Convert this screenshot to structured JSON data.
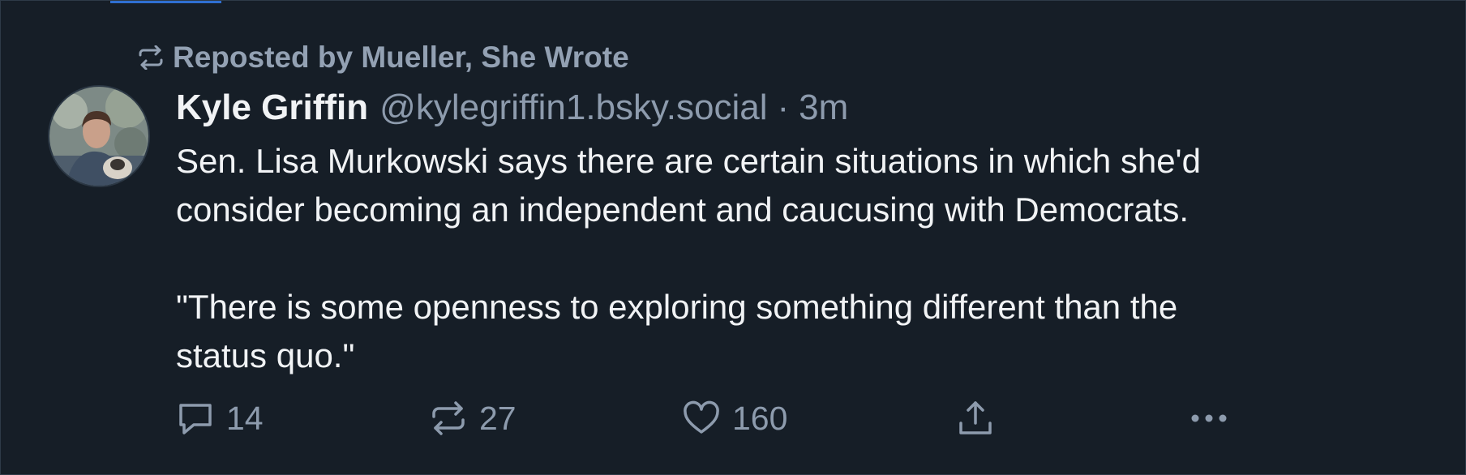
{
  "repost": {
    "icon": "repost-icon",
    "text": "Reposted by Mueller, She Wrote"
  },
  "post": {
    "author_name": "Kyle Griffin",
    "author_handle": "@kylegriffin1.bsky.social",
    "separator": "·",
    "timestamp": "3m",
    "body": {
      "paragraph1_line1": "Sen. Lisa Murkowski says there are certain situations in which she'd",
      "paragraph1_line2": "consider becoming an independent and caucusing with Democrats.",
      "paragraph2_line1": "\"There is some openness to exploring something different than the",
      "paragraph2_line2": "status quo.\""
    }
  },
  "actions": {
    "reply_count": "14",
    "repost_count": "27",
    "like_count": "160"
  },
  "colors": {
    "background": "#161e27",
    "border": "#2e3a47",
    "accent": "#2f6fd1",
    "text_primary": "#f1f3f5",
    "text_secondary": "#8d9bad"
  }
}
